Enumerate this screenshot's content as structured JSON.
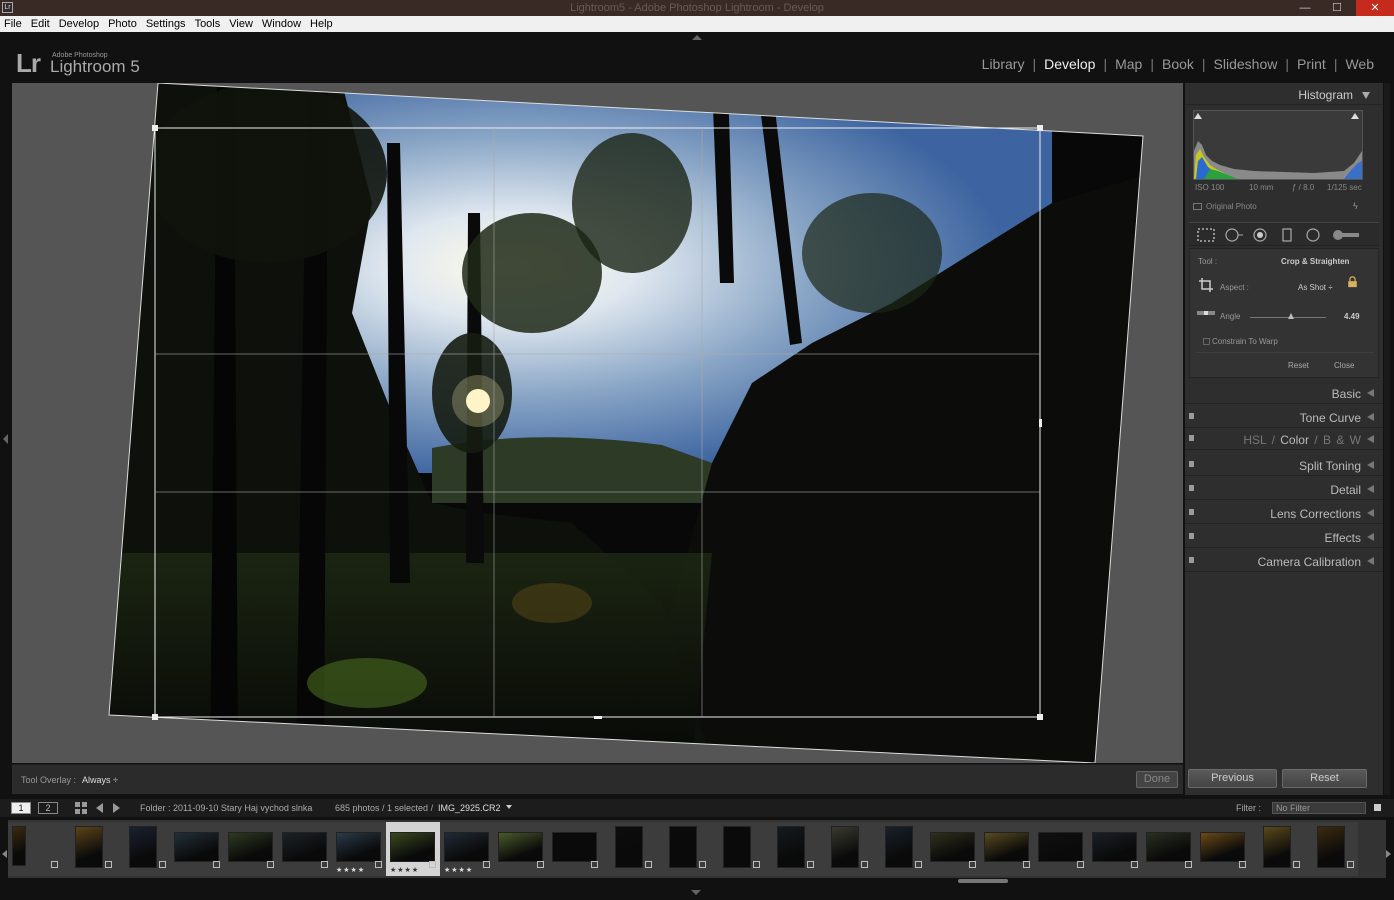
{
  "window": {
    "title": "Lightroom5 - Adobe Photoshop Lightroom - Develop",
    "app_icon": "Lr",
    "minimize": "—",
    "maximize": "☐",
    "close": "✕"
  },
  "menu": [
    "File",
    "Edit",
    "Develop",
    "Photo",
    "Settings",
    "Tools",
    "View",
    "Window",
    "Help"
  ],
  "brand": {
    "logo": "Lr",
    "small": "Adobe Photoshop",
    "big": "Lightroom 5"
  },
  "modules": [
    {
      "label": "Library",
      "active": false
    },
    {
      "label": "Develop",
      "active": true
    },
    {
      "label": "Map",
      "active": false
    },
    {
      "label": "Book",
      "active": false
    },
    {
      "label": "Slideshow",
      "active": false
    },
    {
      "label": "Print",
      "active": false
    },
    {
      "label": "Web",
      "active": false
    }
  ],
  "toolbar": {
    "overlay_label": "Tool Overlay :",
    "overlay_value": "Always ÷",
    "done": "Done"
  },
  "histogram": {
    "title": "Histogram",
    "iso": "ISO 100",
    "focal": "10 mm",
    "aperture": "ƒ / 8.0",
    "shutter": "1/125 sec",
    "original": "Original Photo"
  },
  "crop": {
    "tool_label": "Tool :",
    "tool_value": "Crop & Straighten",
    "aspect_label": "Aspect :",
    "aspect_value": "As Shot ÷",
    "angle_label": "Angle",
    "angle_value": "4.49",
    "angle_fraction": 0.54,
    "constrain": "Constrain To Warp",
    "reset": "Reset",
    "close": "Close"
  },
  "panels": {
    "basic": "Basic",
    "tone_curve": "Tone Curve",
    "hsl": "HSL",
    "hsl_sep": "/",
    "color": "Color",
    "bw": "B & W",
    "split_toning": "Split Toning",
    "detail": "Detail",
    "lens": "Lens Corrections",
    "effects": "Effects",
    "camera": "Camera Calibration"
  },
  "bottom_buttons": {
    "previous": "Previous",
    "reset": "Reset"
  },
  "filmbar": {
    "screen1": "1",
    "screen2": "2",
    "folder": "Folder : 2011-09-10 Stary Haj vychod slnka",
    "count": "685 photos / 1 selected /",
    "file": "IMG_2925.CR2",
    "filter_label": "Filter :",
    "filter_value": "No Filter"
  },
  "filmstrip": {
    "star_rating": "★★★★",
    "selected_index": 7
  },
  "colors": {
    "accent": "#eeeeee",
    "panel": "#2e2e2e",
    "stage": "#555555"
  }
}
